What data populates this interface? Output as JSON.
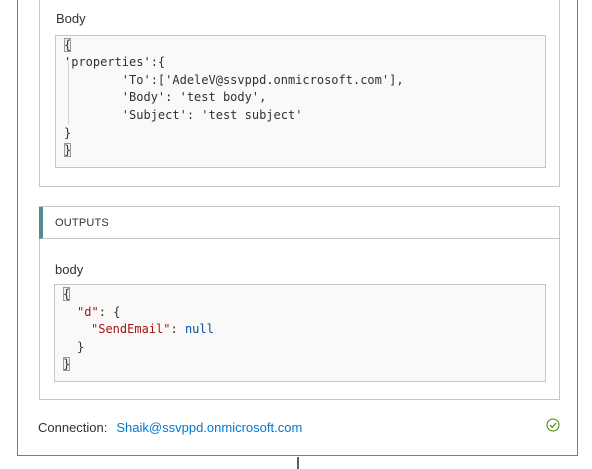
{
  "inputs": {
    "body_label": "Body",
    "code_lines": [
      "{",
      "'properties':{",
      "        'To':['AdeleV@ssvppd.onmicrosoft.com'],",
      "        'Body': 'test body',",
      "        'Subject': 'test subject'",
      "}",
      "}"
    ]
  },
  "outputs": {
    "header": "OUTPUTS",
    "body_label": "body",
    "code": {
      "open_brace": "{",
      "d_key": "\"d\"",
      "d_sep": ": {",
      "send_email_key": "\"SendEmail\"",
      "send_email_sep": ": ",
      "send_email_value": "null",
      "inner_close": "}",
      "close_brace": "}"
    }
  },
  "connection": {
    "label": "Connection:",
    "value": "Shaik@ssvppd.onmicrosoft.com",
    "status_icon": "success-check-icon",
    "status_color": "#498205"
  },
  "colors": {
    "accent": "#4f8c8f",
    "link": "#0078d4",
    "json_key": "#a31515",
    "json_keyword": "#0451a5"
  }
}
